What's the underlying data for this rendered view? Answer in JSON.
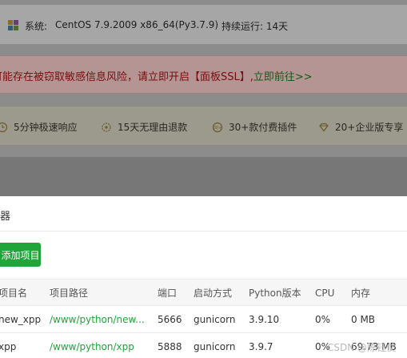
{
  "system": {
    "label": "系统:",
    "os": "CentOS 7.9.2009 x86_64(Py3.7.9)",
    "uptime": "持续运行: 14天"
  },
  "alert": {
    "text": "可能存在被窃取敏感信息风险，请立即开启【面板SSL】,",
    "link": "立即前往>>"
  },
  "features": [
    {
      "icon": "clock-icon",
      "label": "5分钟极速响应"
    },
    {
      "icon": "refund-icon",
      "label": "15天无理由退款"
    },
    {
      "icon": "plugin-icon",
      "label": "30+款付费插件"
    },
    {
      "icon": "diamond-icon",
      "label": "20+企业版专享"
    }
  ],
  "modal": {
    "title": "器",
    "add_button": "添加项目"
  },
  "table": {
    "headers": [
      "项目名",
      "项目路径",
      "端口",
      "启动方式",
      "Python版本",
      "CPU",
      "内存"
    ],
    "rows": [
      {
        "name": "new_xpp",
        "path": "/www/python/new...",
        "port": "5666",
        "start": "gunicorn",
        "python": "3.9.10",
        "cpu": "0%",
        "mem": "0 MB"
      },
      {
        "name": "xpp",
        "path": "/www/python/xpp",
        "port": "5888",
        "start": "gunicorn",
        "python": "3.9.7",
        "cpu": "0%",
        "mem": "69.73 MB"
      }
    ]
  },
  "watermark": "CSDN @陈钰仗",
  "colors": {
    "accent": "#20a53a",
    "alert_text": "#7a0d0d"
  }
}
